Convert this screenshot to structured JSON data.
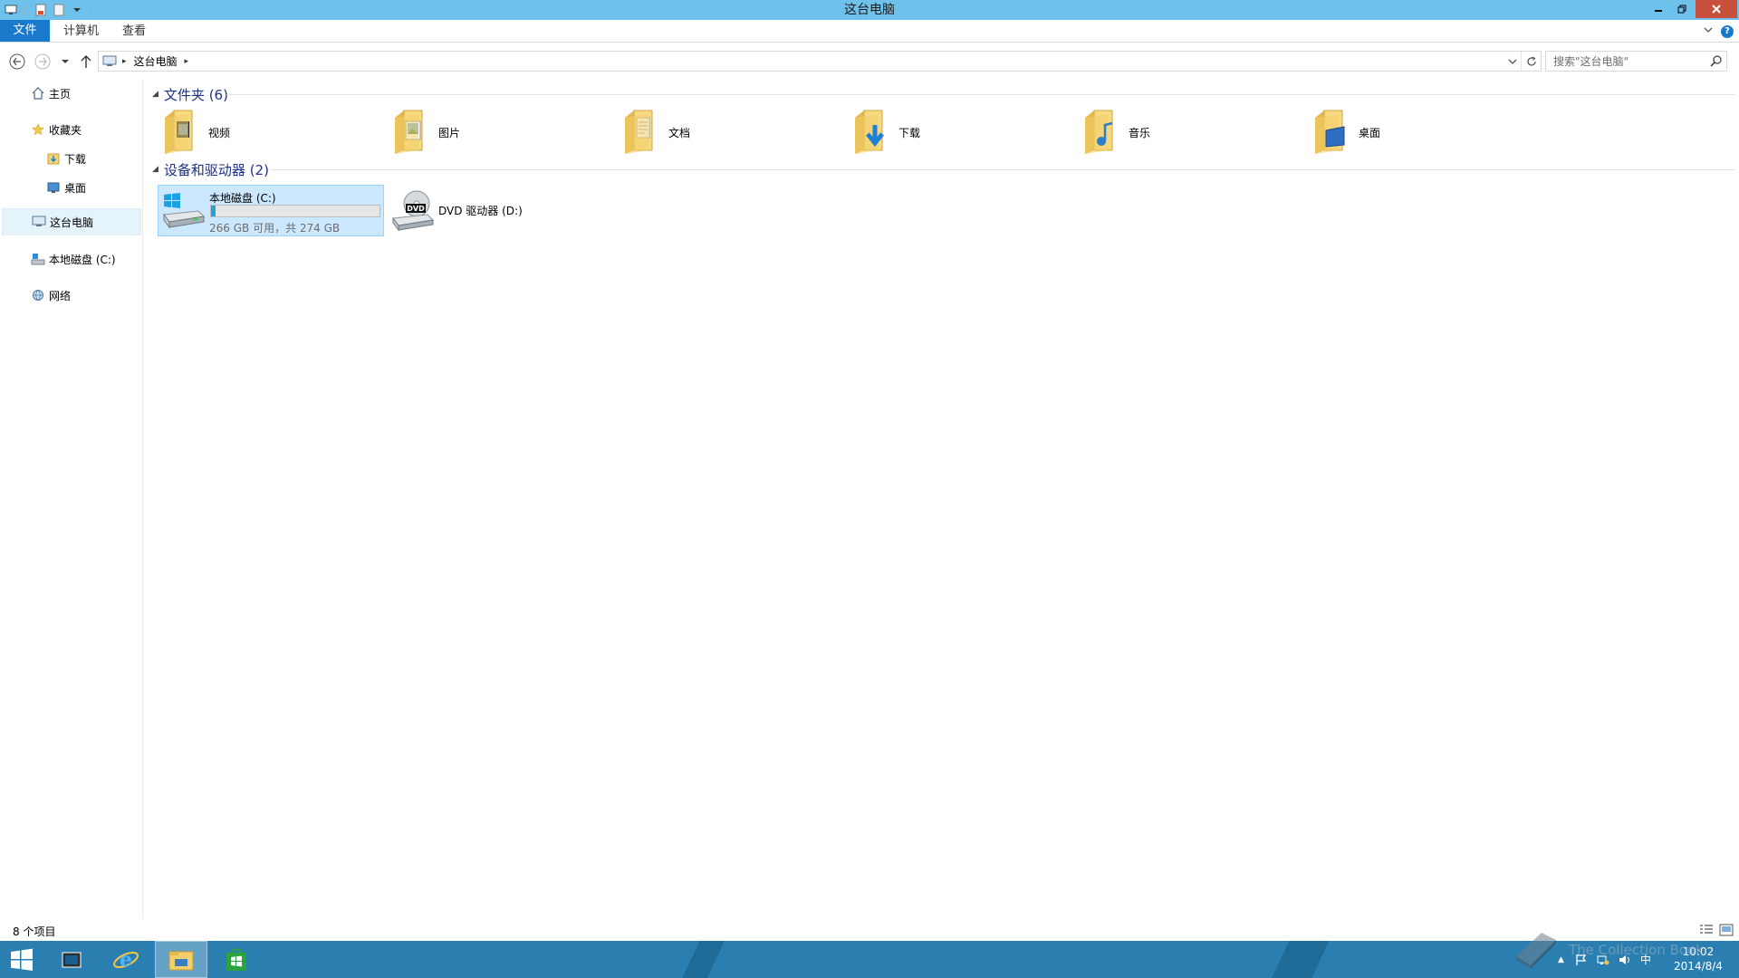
{
  "window": {
    "title": "这台电脑"
  },
  "ribbon": {
    "tabs": [
      "文件",
      "计算机",
      "查看"
    ]
  },
  "address": {
    "segments": [
      "这台电脑"
    ],
    "search_placeholder": "搜索\"这台电脑\""
  },
  "sidebar": {
    "items": [
      {
        "label": "主页",
        "icon": "home-icon"
      },
      {
        "label": "收藏夹",
        "icon": "star-icon"
      },
      {
        "label": "下载",
        "icon": "download-folder-icon"
      },
      {
        "label": "桌面",
        "icon": "desktop-icon"
      },
      {
        "label": "这台电脑",
        "icon": "computer-icon",
        "selected": true
      },
      {
        "label": "本地磁盘 (C:)",
        "icon": "drive-icon"
      },
      {
        "label": "网络",
        "icon": "network-icon"
      }
    ]
  },
  "folders": {
    "header": "文件夹 (6)",
    "items": [
      {
        "label": "视频",
        "icon": "videos-folder-icon"
      },
      {
        "label": "图片",
        "icon": "pictures-folder-icon"
      },
      {
        "label": "文档",
        "icon": "documents-folder-icon"
      },
      {
        "label": "下载",
        "icon": "downloads-folder-icon"
      },
      {
        "label": "音乐",
        "icon": "music-folder-icon"
      },
      {
        "label": "桌面",
        "icon": "desktop-folder-icon"
      }
    ]
  },
  "devices": {
    "header": "设备和驱动器 (2)",
    "items": [
      {
        "label": "本地磁盘 (C:)",
        "free_text": "266 GB 可用，共 274 GB",
        "used_fraction": 0.029,
        "icon": "windows-drive-icon"
      },
      {
        "label": "DVD 驱动器 (D:)",
        "icon": "dvd-drive-icon"
      }
    ]
  },
  "status": {
    "items_count": "8 个项目"
  },
  "taskbar": {
    "clock_time": "10:02",
    "clock_date": "2014/8/4",
    "ime": "中",
    "watermark": "The Collection Book"
  },
  "colors": {
    "titlebar": "#6ec1ea",
    "accent": "#1979ca",
    "close": "#c7503c",
    "taskbar": "#2a7fb0",
    "selection": "#cce8ff"
  }
}
